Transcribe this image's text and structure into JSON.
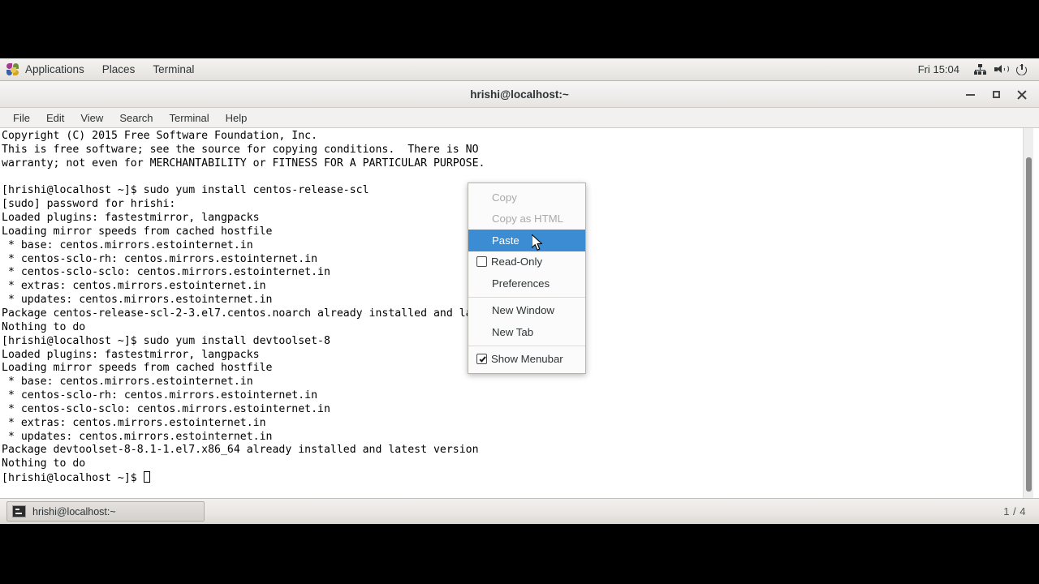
{
  "top_panel": {
    "apps_label": "Applications",
    "places_label": "Places",
    "terminal_label": "Terminal",
    "clock": "Fri 15:04",
    "icons": [
      "applications-pinwheel-icon",
      "network-icon",
      "volume-icon",
      "power-icon"
    ]
  },
  "window": {
    "title": "hrishi@localhost:~",
    "controls": {
      "minimize": "minimize-icon",
      "maximize": "maximize-icon",
      "close": "close-icon"
    },
    "menubar": [
      "File",
      "Edit",
      "View",
      "Search",
      "Terminal",
      "Help"
    ]
  },
  "terminal": {
    "lines": [
      "Copyright (C) 2015 Free Software Foundation, Inc.",
      "This is free software; see the source for copying conditions.  There is NO",
      "warranty; not even for MERCHANTABILITY or FITNESS FOR A PARTICULAR PURPOSE.",
      "",
      "[hrishi@localhost ~]$ sudo yum install centos-release-scl",
      "[sudo] password for hrishi:",
      "Loaded plugins: fastestmirror, langpacks",
      "Loading mirror speeds from cached hostfile",
      " * base: centos.mirrors.estointernet.in",
      " * centos-sclo-rh: centos.mirrors.estointernet.in",
      " * centos-sclo-sclo: centos.mirrors.estointernet.in",
      " * extras: centos.mirrors.estointernet.in",
      " * updates: centos.mirrors.estointernet.in",
      "Package centos-release-scl-2-3.el7.centos.noarch already installed and latest version",
      "Nothing to do",
      "[hrishi@localhost ~]$ sudo yum install devtoolset-8",
      "Loaded plugins: fastestmirror, langpacks",
      "Loading mirror speeds from cached hostfile",
      " * base: centos.mirrors.estointernet.in",
      " * centos-sclo-rh: centos.mirrors.estointernet.in",
      " * centos-sclo-sclo: centos.mirrors.estointernet.in",
      " * extras: centos.mirrors.estointernet.in",
      " * updates: centos.mirrors.estointernet.in",
      "Package devtoolset-8-8.1-1.el7.x86_64 already installed and latest version",
      "Nothing to do"
    ],
    "prompt": "[hrishi@localhost ~]$ "
  },
  "context_menu": {
    "items": [
      {
        "label": "Copy",
        "state": "disabled",
        "type": "plain"
      },
      {
        "label": "Copy as HTML",
        "state": "disabled",
        "type": "plain"
      },
      {
        "label": "Paste",
        "state": "highlight",
        "type": "plain"
      },
      {
        "label": "Read-Only",
        "state": "normal",
        "type": "checkbox",
        "checked": false
      },
      {
        "label": "Preferences",
        "state": "normal",
        "type": "plain"
      },
      {
        "label": "New Window",
        "state": "normal",
        "type": "plain",
        "separator_before": true
      },
      {
        "label": "New Tab",
        "state": "normal",
        "type": "plain"
      },
      {
        "label": "Show Menubar",
        "state": "normal",
        "type": "checkbox",
        "checked": true,
        "separator_before": true
      }
    ],
    "highlight_color": "#3c8cd4"
  },
  "bottom_panel": {
    "task_label": "hrishi@localhost:~",
    "task_icon": "terminal-icon",
    "workspace": "1 / 4"
  }
}
